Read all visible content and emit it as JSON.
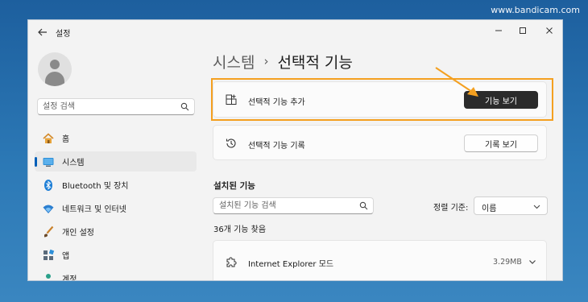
{
  "watermark": "www.bandicam.com",
  "window": {
    "app_title": "설정",
    "controls": {
      "minimize": "—",
      "maximize": "☐",
      "close": "✕"
    }
  },
  "sidebar": {
    "search_placeholder": "설정 검색",
    "items": [
      {
        "label": "홈",
        "icon": "home-icon",
        "active": false
      },
      {
        "label": "시스템",
        "icon": "system-icon",
        "active": true
      },
      {
        "label": "Bluetooth 및 장치",
        "icon": "bluetooth-icon",
        "active": false
      },
      {
        "label": "네트워크 및 인터넷",
        "icon": "wifi-icon",
        "active": false
      },
      {
        "label": "개인 설정",
        "icon": "brush-icon",
        "active": false
      },
      {
        "label": "앱",
        "icon": "apps-icon",
        "active": false
      },
      {
        "label": "계정",
        "icon": "account-icon",
        "active": false
      }
    ]
  },
  "breadcrumb": {
    "parent": "시스템",
    "separator": "›",
    "current": "선택적 기능"
  },
  "cards": {
    "add_feature": {
      "label": "선택적 기능 추가",
      "button": "기능 보기"
    },
    "history": {
      "label": "선택적 기능 기록",
      "button": "기록 보기"
    }
  },
  "installed": {
    "title": "설치된 기능",
    "search_placeholder": "설치된 기능 검색",
    "sort_label": "정렬 기준:",
    "sort_value": "이름",
    "count_text": "36개 기능 찾음",
    "features": [
      {
        "name": "Internet Explorer 모드",
        "size": "3.29MB"
      }
    ]
  },
  "colors": {
    "accent": "#005fb8",
    "highlight": "#f4a020",
    "dark_button": "#2b2b2b"
  }
}
